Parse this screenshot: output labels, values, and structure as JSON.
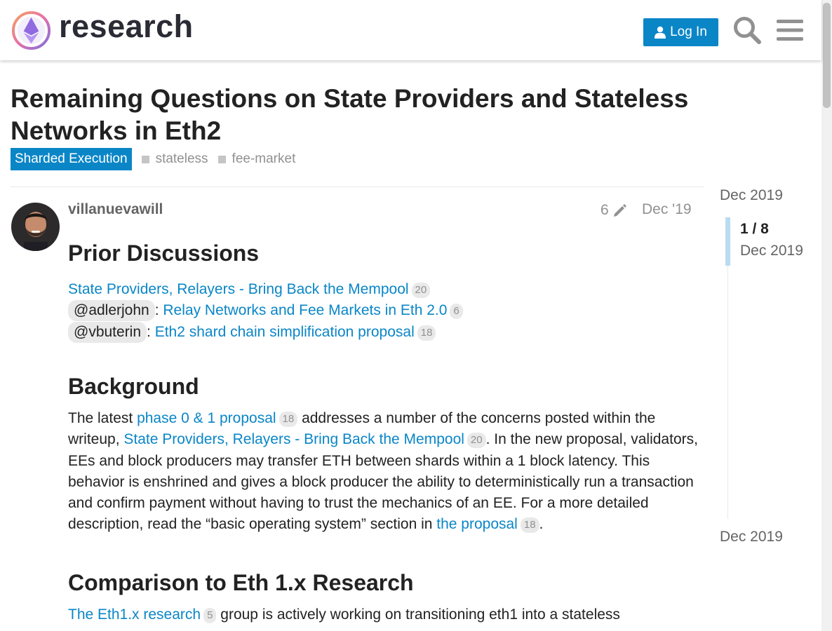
{
  "header": {
    "brand": "research",
    "login_label": "Log In"
  },
  "topic": {
    "title": "Remaining Questions on State Providers and Stateless Networks in Eth2",
    "category": "Sharded Execution",
    "tags": [
      "stateless",
      "fee-market"
    ]
  },
  "post": {
    "username": "villanuevawill",
    "edit_count": "6",
    "date": "Dec '19",
    "prior": {
      "heading": "Prior Discussions",
      "link1": "State Providers, Relayers - Bring Back the Mempool",
      "link1_count": "20",
      "mention2": "@adlerjohn",
      "link2": "Relay Networks and Fee Markets in Eth 2.0",
      "link2_count": "6",
      "mention3": "@vbuterin",
      "link3": "Eth2 shard chain simplification proposal",
      "link3_count": "18",
      "sep": ": "
    },
    "background": {
      "heading": "Background",
      "t1": "The latest ",
      "l1": "phase 0 & 1 proposal",
      "c1": "18",
      "t2": " addresses a number of the concerns posted within the writeup, ",
      "l2": "State Providers, Relayers - Bring Back the Mempool",
      "c2": "20",
      "t3": ". In the new proposal, validators, EEs and block producers may transfer ETH between shards within a 1 block latency. This behavior is enshrined and gives a block producer the ability to deterministically run a transaction and confirm payment without having to trust the mechanics of an EE. For a more detailed description, read the “basic operating system” section in ",
      "l3": "the proposal",
      "c3": "18",
      "t4": "."
    },
    "comparison": {
      "heading": "Comparison to Eth 1.x Research",
      "l1": "The Eth1.x research",
      "c1": "5",
      "t1": " group is actively working on transitioning eth1 into a stateless"
    }
  },
  "timeline": {
    "top_date": "Dec 2019",
    "position": "1 / 8",
    "position_date": "Dec 2019",
    "bottom_date": "Dec 2019"
  },
  "colors": {
    "accent": "#0a86c7",
    "muted": "#919191",
    "badge_bg": "#e9e9e9"
  }
}
